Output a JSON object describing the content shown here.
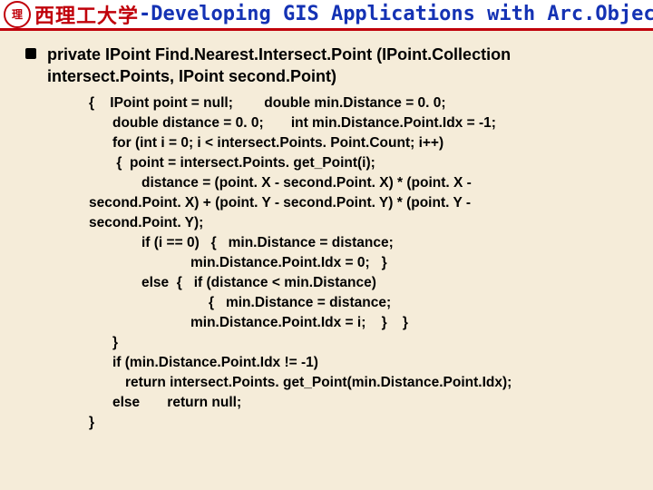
{
  "header": {
    "univ_cn": "西理工大学",
    "dash": " - ",
    "title_en": "Developing GIS Applications with Arc.Objects using C#. NE"
  },
  "signature": "private IPoint Find.Nearest.Intersect.Point (IPoint.Collection intersect.Points, IPoint second.Point)",
  "code": {
    "l1": "{    IPoint point = null;        double min.Distance = 0. 0;",
    "l2": "double distance = 0. 0;       int min.Distance.Point.Idx = -1;",
    "l3": "for (int i = 0; i < intersect.Points. Point.Count; i++)",
    "l4": " {  point = intersect.Points. get_Point(i);",
    "l5": "distance = (point. X - second.Point. X) * (point. X -",
    "l5b": "second.Point. X) + (point. Y - second.Point. Y) * (point. Y -",
    "l5c": "second.Point. Y);",
    "l6": "if (i == 0)   {   min.Distance = distance;",
    "l7": "min.Distance.Point.Idx = 0;   }",
    "l8": "else  {   if (distance < min.Distance)",
    "l9": "{   min.Distance = distance;",
    "l10": "min.Distance.Point.Idx = i;    }    }",
    "l11": "}",
    "l12": "if (min.Distance.Point.Idx != -1)",
    "l13": "return intersect.Points. get_Point(min.Distance.Point.Idx);",
    "l14": "else       return null;",
    "l15": "}"
  }
}
